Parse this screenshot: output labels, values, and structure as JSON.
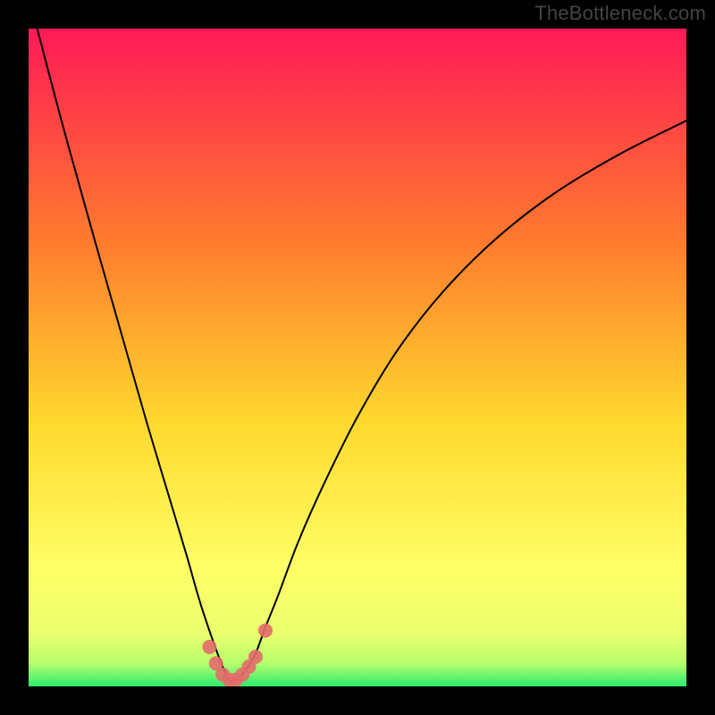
{
  "watermark": "TheBottleneck.com",
  "colors": {
    "frame": "#000000",
    "gradient_top": "#ff1a56",
    "gradient_mid1": "#ff7a2e",
    "gradient_mid2": "#ffd92e",
    "gradient_mid3": "#ffff66",
    "gradient_bottom": "#2eea6e",
    "curve": "#000000",
    "dots": "#e46a6a"
  },
  "chart_data": {
    "type": "line",
    "title": "",
    "xlabel": "",
    "ylabel": "",
    "xlim": [
      0,
      100
    ],
    "ylim": [
      0,
      100
    ],
    "series": [
      {
        "name": "bottleneck-curve",
        "x": [
          0,
          5,
          10,
          14,
          18,
          21,
          24,
          26,
          28,
          29.5,
          30.5,
          31.5,
          33,
          34.5,
          36,
          38,
          41,
          45,
          50,
          56,
          63,
          71,
          80,
          90,
          100
        ],
        "y": [
          105,
          86,
          68,
          54,
          40,
          30,
          20,
          13,
          7,
          3,
          1,
          1,
          2.5,
          5,
          9,
          14,
          22,
          31,
          41,
          51,
          60,
          68,
          75,
          81,
          86
        ]
      }
    ],
    "dots": {
      "name": "highlight-dots",
      "x": [
        27.5,
        28.5,
        29.5,
        30.5,
        31.5,
        32.5,
        33.5,
        34.5,
        36.0
      ],
      "y": [
        6.0,
        3.5,
        1.8,
        1.0,
        1.0,
        1.8,
        3.0,
        4.5,
        8.5
      ]
    },
    "legend": []
  }
}
